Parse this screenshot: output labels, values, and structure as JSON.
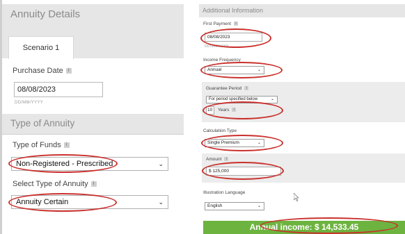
{
  "annuity_details": {
    "title": "Annuity Details",
    "tab_label": "Scenario 1",
    "purchase_date_label": "Purchase Date",
    "purchase_date_value": "08/08/2023",
    "purchase_date_hint": "DD/MM/YYYY"
  },
  "type_of_annuity": {
    "title": "Type of Annuity",
    "funds_label": "Type of Funds",
    "funds_value": "Non-Registered - Prescribed",
    "select_label": "Select Type of Annuity",
    "select_value": "Annuity Certain"
  },
  "additional_info": {
    "title": "Additional Information",
    "first_payment_label": "First Payment",
    "first_payment_value": "08/08/2023",
    "first_payment_hint": "DD/MM/YYYY",
    "income_frequency_label": "Income Frequency",
    "income_frequency_value": "Annual",
    "guarantee_period_label": "Guarantee Period",
    "guarantee_period_type": "For period specified below",
    "guarantee_years_value": "10",
    "guarantee_years_unit": "Years",
    "calculation_type_label": "Calculation Type",
    "calculation_type_value": "Single Premium",
    "amount_label": "Amount",
    "amount_prefix": "$",
    "amount_value": "125,000",
    "illustration_language_label": "Illustration Language",
    "illustration_language_value": "English"
  },
  "result": {
    "annual_income_text": "Annual income: $ 14,533.45"
  },
  "icons": {
    "info": "i",
    "chevron": "⌄"
  },
  "colors": {
    "highlight_oval": "#c9302c",
    "income_bar": "#6db33f",
    "header_bg": "#e6e6e6"
  }
}
